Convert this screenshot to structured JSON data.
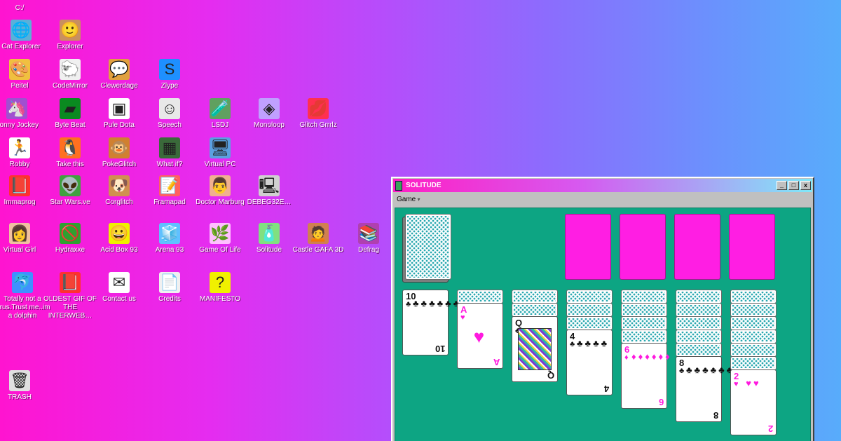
{
  "desktop": {
    "path": "C:/",
    "icons": [
      {
        "label": "Cat Explorer",
        "glyph": "🌐"
      },
      {
        "label": "Explorer",
        "glyph": "🙂"
      },
      {
        "label": "Peitel",
        "glyph": "🎨"
      },
      {
        "label": "CodeMirror",
        "glyph": "🐑"
      },
      {
        "label": "Clewerdage",
        "glyph": "💬"
      },
      {
        "label": "Zlype",
        "glyph": "S"
      },
      {
        "label": "Ponny Jockey",
        "glyph": "🦄"
      },
      {
        "label": "Byte Beat",
        "glyph": "▰"
      },
      {
        "label": "Pule Dota",
        "glyph": "▣"
      },
      {
        "label": "Speech",
        "glyph": "☺"
      },
      {
        "label": "LSDJ",
        "glyph": "🧪"
      },
      {
        "label": "Monoloop",
        "glyph": "◈"
      },
      {
        "label": "Glitch Grrrlz",
        "glyph": "💋"
      },
      {
        "label": "Robby",
        "glyph": "🏃"
      },
      {
        "label": "Take this",
        "glyph": "🐧"
      },
      {
        "label": "PokeGlitch",
        "glyph": "🐵"
      },
      {
        "label": "What if?",
        "glyph": "▦"
      },
      {
        "label": "Virtual PC",
        "glyph": "🖥"
      },
      {
        "label": "Immaprog",
        "glyph": "📕"
      },
      {
        "label": "Star Wars.ve",
        "glyph": "👽"
      },
      {
        "label": "Corglitch",
        "glyph": "🐶"
      },
      {
        "label": "Framapad",
        "glyph": "📝"
      },
      {
        "label": "Doctor Marburg",
        "glyph": "👨"
      },
      {
        "label": "DEBEG32E…",
        "glyph": "🖳"
      },
      {
        "label": "Virtual Girl",
        "glyph": "👩"
      },
      {
        "label": "Hydraxxe",
        "glyph": "🚫"
      },
      {
        "label": "Acid Box 93",
        "glyph": "😀"
      },
      {
        "label": "Arena 93",
        "glyph": "🧊"
      },
      {
        "label": "Game Of Life",
        "glyph": "🌿"
      },
      {
        "label": "Solitude",
        "glyph": "🧴"
      },
      {
        "label": "Castle GAFA 3D",
        "glyph": "🙍"
      },
      {
        "label": "Defrag",
        "glyph": "📚"
      },
      {
        "label": "Totally not a virus.Trust me..im a dolphin",
        "glyph": "🐬"
      },
      {
        "label": "OLDEST GIF OF THE INTERWEB…",
        "glyph": "📕"
      },
      {
        "label": "Contact us",
        "glyph": "✉"
      },
      {
        "label": "Credits",
        "glyph": "📄"
      },
      {
        "label": "MANIFESTO",
        "glyph": "?"
      },
      {
        "label": "TRASH",
        "glyph": "🗑"
      }
    ]
  },
  "window": {
    "title": "SOLITUDE",
    "menu": [
      "Game"
    ],
    "controls": {
      "minimize": "_",
      "maximize": "□",
      "close": "x"
    }
  },
  "tableau": {
    "columns": [
      {
        "hidden": 0,
        "faces": [
          {
            "rank": "10",
            "suit": "♣",
            "color": "black"
          }
        ]
      },
      {
        "hidden": 1,
        "faces": [
          {
            "rank": "A",
            "suit": "♥",
            "color": "red"
          }
        ]
      },
      {
        "hidden": 2,
        "faces": [
          {
            "rank": "Q",
            "suit": "♣",
            "color": "black"
          }
        ]
      },
      {
        "hidden": 3,
        "faces": [
          {
            "rank": "4",
            "suit": "♣",
            "color": "black"
          }
        ]
      },
      {
        "hidden": 4,
        "faces": [
          {
            "rank": "6",
            "suit": "♦",
            "color": "red"
          }
        ]
      },
      {
        "hidden": 5,
        "faces": [
          {
            "rank": "8",
            "suit": "♣",
            "color": "black"
          }
        ]
      },
      {
        "hidden": 6,
        "faces": [
          {
            "rank": "2",
            "suit": "♥",
            "color": "red"
          }
        ]
      }
    ]
  }
}
